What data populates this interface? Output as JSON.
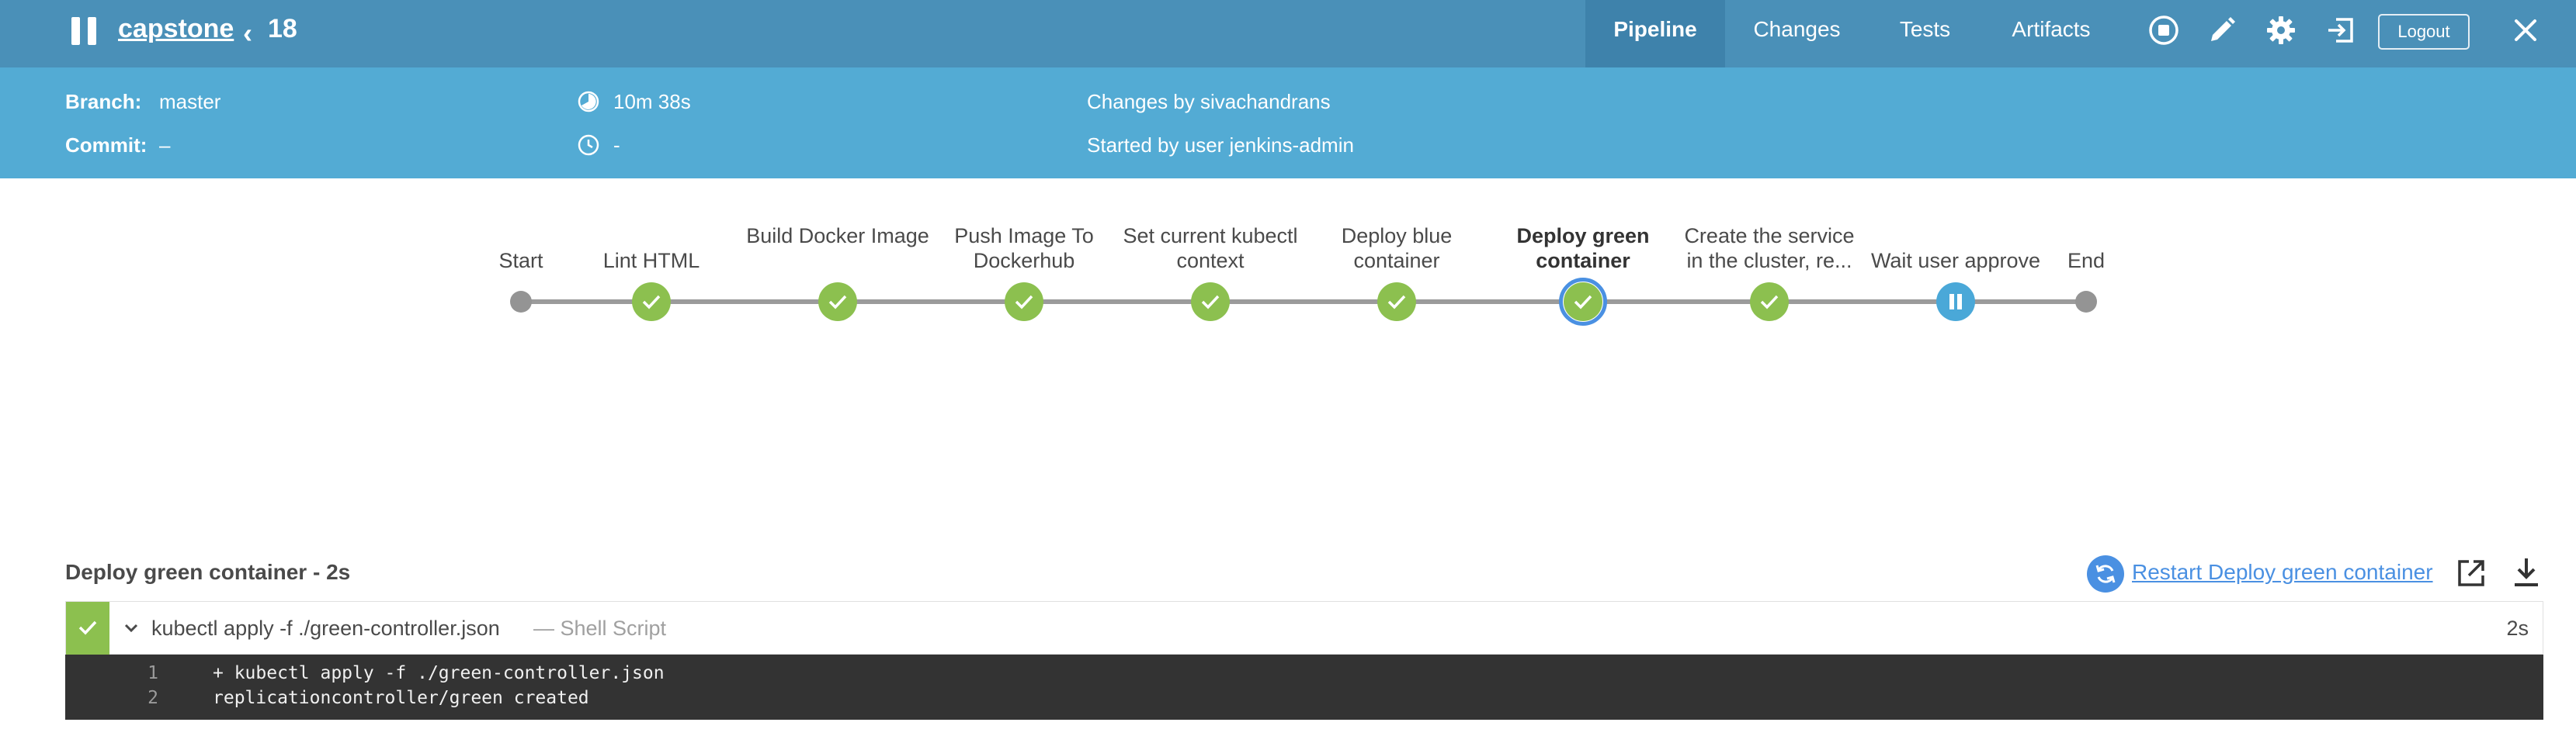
{
  "header": {
    "project": "capstone",
    "run_number": "18",
    "tabs": [
      {
        "label": "Pipeline",
        "active": true
      },
      {
        "label": "Changes",
        "active": false
      },
      {
        "label": "Tests",
        "active": false
      },
      {
        "label": "Artifacts",
        "active": false
      }
    ],
    "logout_label": "Logout",
    "icons": [
      "pause-icon",
      "stop-icon",
      "edit-icon",
      "gear-icon",
      "exit-icon",
      "close-icon"
    ],
    "colors": {
      "topbar": "#4a90b8",
      "active_tab": "#3e82ab",
      "infobar": "#53abd4"
    }
  },
  "info": {
    "branch_label": "Branch:",
    "branch": "master",
    "commit_label": "Commit:",
    "commit": "–",
    "duration": "10m 38s",
    "time": "-",
    "changes": "Changes by sivachandrans",
    "started": "Started by user jenkins-admin"
  },
  "pipeline": {
    "stages": [
      {
        "label": "Start",
        "status": "start"
      },
      {
        "label": "Lint HTML",
        "status": "success"
      },
      {
        "label": "Build Docker Image",
        "status": "success"
      },
      {
        "label": "Push Image To Dockerhub",
        "status": "success"
      },
      {
        "label": "Set current kubectl context",
        "status": "success"
      },
      {
        "label": "Deploy blue container",
        "status": "success"
      },
      {
        "label": "Deploy green container",
        "status": "success",
        "selected": true
      },
      {
        "label": "Create the service in the cluster, re...",
        "status": "success"
      },
      {
        "label": "Wait user approve",
        "status": "paused"
      },
      {
        "label": "End",
        "status": "end"
      }
    ],
    "colors": {
      "success": "#8cc04f",
      "paused": "#4aa8d8",
      "selected_ring": "#4a90e2",
      "rail": "#9b9b9b"
    }
  },
  "step": {
    "title": "Deploy green container - 2s",
    "restart_label": "Restart Deploy green container",
    "command": "kubectl apply -f ./green-controller.json",
    "type": "— Shell Script",
    "duration": "2s",
    "status": "success"
  },
  "console": [
    {
      "num": "1",
      "text": "+ kubectl apply -f ./green-controller.json"
    },
    {
      "num": "2",
      "text": "replicationcontroller/green created"
    }
  ]
}
